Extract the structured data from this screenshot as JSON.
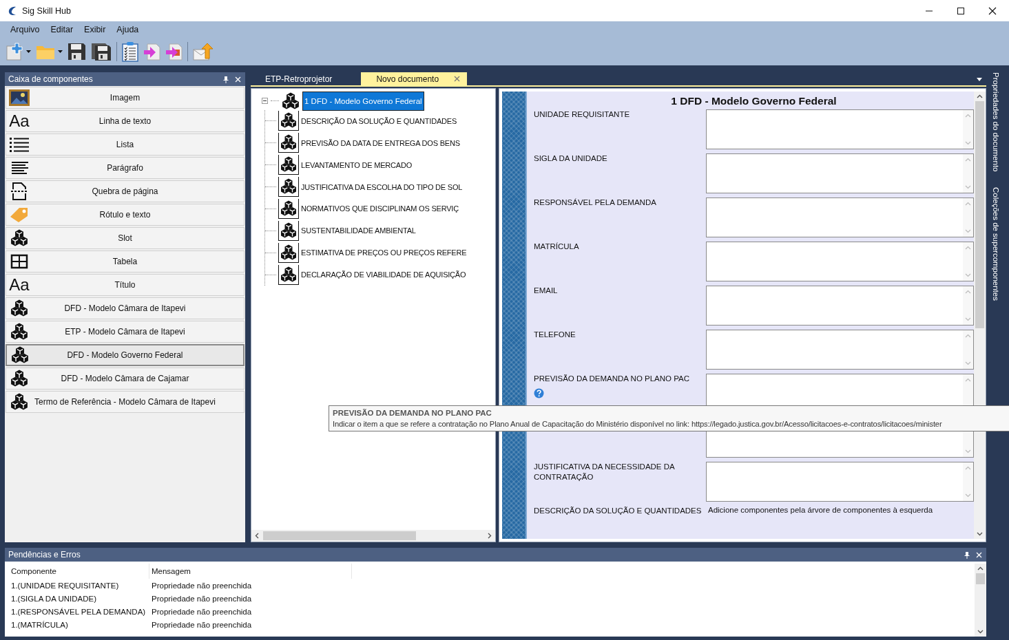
{
  "window": {
    "title": "Sig Skill Hub"
  },
  "menu": [
    "Arquivo",
    "Editar",
    "Exibir",
    "Ajuda"
  ],
  "toolbar": [
    {
      "kind": "new",
      "dropdown": true
    },
    {
      "kind": "open",
      "dropdown": true
    },
    {
      "kind": "save",
      "dropdown": false
    },
    {
      "kind": "save_all",
      "dropdown": false
    },
    {
      "kind": "separator"
    },
    {
      "kind": "clipboard",
      "dropdown": false
    },
    {
      "kind": "import",
      "dropdown": false
    },
    {
      "kind": "import_image",
      "dropdown": false
    },
    {
      "kind": "separator"
    },
    {
      "kind": "mail",
      "dropdown": false
    }
  ],
  "toolbox": {
    "title": "Caixa de componentes",
    "items": [
      {
        "label": "Imagem",
        "kind": "image",
        "selected": false
      },
      {
        "label": "Linha de texto",
        "kind": "glyph",
        "glyph": "Aa",
        "selected": false
      },
      {
        "label": "Lista",
        "kind": "list",
        "selected": false
      },
      {
        "label": "Parágrafo",
        "kind": "paragraph",
        "selected": false
      },
      {
        "label": "Quebra de página",
        "kind": "pagebreak",
        "selected": false
      },
      {
        "label": "Rótulo e texto",
        "kind": "tag",
        "selected": false
      },
      {
        "label": "Slot",
        "kind": "cubes",
        "selected": false
      },
      {
        "label": "Tabela",
        "kind": "table",
        "selected": false
      },
      {
        "label": "Título",
        "kind": "glyph",
        "glyph": "Aa",
        "selected": false
      },
      {
        "label": "DFD - Modelo Câmara de Itapevi",
        "kind": "cubes",
        "selected": false
      },
      {
        "label": "ETP - Modelo Câmara de Itapevi",
        "kind": "cubes",
        "selected": false
      },
      {
        "label": "DFD - Modelo Governo Federal",
        "kind": "cubes",
        "selected": true
      },
      {
        "label": "DFD - Modelo Câmara de Cajamar",
        "kind": "cubes",
        "selected": false
      },
      {
        "label": "Termo de Referência - Modelo Câmara de Itapevi",
        "kind": "cubes",
        "selected": false
      }
    ]
  },
  "tabs": [
    {
      "label": "ETP-Retroprojetor",
      "selected": false,
      "closable": false
    },
    {
      "label": "Novo documento",
      "selected": true,
      "closable": true
    }
  ],
  "tree": {
    "root": {
      "label": "1 DFD - Modelo Governo Federal",
      "expanded": true,
      "selected": true,
      "children": [
        {
          "label": "DESCRIÇÃO DA SOLUÇÃO E QUANTIDADES",
          "selected": false
        },
        {
          "label": "PREVISÃO DA DATA DE ENTREGA DOS BENS",
          "selected": false
        },
        {
          "label": "LEVANTAMENTO DE MERCADO",
          "selected": false
        },
        {
          "label": "JUSTIFICATIVA DA ESCOLHA DO TIPO DE SOL",
          "selected": false
        },
        {
          "label": "NORMATIVOS QUE DISCIPLINAM OS SERVIÇ",
          "selected": false
        },
        {
          "label": "SUSTENTABILIDADE AMBIENTAL",
          "selected": false
        },
        {
          "label": "ESTIMATIVA DE PREÇOS OU PREÇOS REFERE",
          "selected": false
        },
        {
          "label": "DECLARAÇÃO DE VIABILIDADE DE AQUISIÇÃO",
          "selected": false
        }
      ]
    }
  },
  "form": {
    "title": "1 DFD - Modelo Governo Federal",
    "fields": [
      {
        "label": "UNIDADE REQUISITANTE",
        "kind": "textarea",
        "help": false
      },
      {
        "label": "SIGLA DA UNIDADE",
        "kind": "textarea",
        "help": false
      },
      {
        "label": "RESPONSÁVEL PELA DEMANDA",
        "kind": "textarea",
        "help": false
      },
      {
        "label": "MATRÍCULA",
        "kind": "textarea",
        "help": false
      },
      {
        "label": "EMAIL",
        "kind": "textarea",
        "help": false
      },
      {
        "label": "TELEFONE",
        "kind": "textarea",
        "help": false
      },
      {
        "label": "PREVISÃO DA DEMANDA NO PLANO PAC",
        "kind": "textarea",
        "help": true
      },
      {
        "kind": "textarea",
        "help": false
      },
      {
        "label": "JUSTIFICATIVA DA NECESSIDADE DA CONTRATAÇÃO",
        "kind": "textarea",
        "help": false
      },
      {
        "label": "DESCRIÇÃO DA SOLUÇÃO E QUANTIDADES",
        "kind": "hint",
        "hint": "Adicione componentes pela árvore de componentes à esquerda",
        "help": false
      }
    ]
  },
  "tooltip": {
    "title": "PREVISÃO DA DEMANDA NO PLANO PAC",
    "text": "Indicar o item a que se refere a contratação no Plano Anual de Capacitação do Ministério disponível no link: https://legado.justica.gov.br/Acesso/licitacoes-e-contratos/licitacoes/minister"
  },
  "side_tabs": [
    "Propriedades do documento",
    "Coleções de supercomponentes"
  ],
  "issues": {
    "title": "Pendências e Erros",
    "columns": [
      "Componente",
      "Mensagem"
    ],
    "rows": [
      [
        "1.(UNIDADE REQUISITANTE)",
        "Propriedade não preenchida"
      ],
      [
        "1.(SIGLA DA UNIDADE)",
        "Propriedade não preenchida"
      ],
      [
        "1.(RESPONSÁVEL PELA DEMANDA)",
        "Propriedade não preenchida"
      ],
      [
        "1.(MATRÍCULA)",
        "Propriedade não preenchida"
      ]
    ]
  }
}
